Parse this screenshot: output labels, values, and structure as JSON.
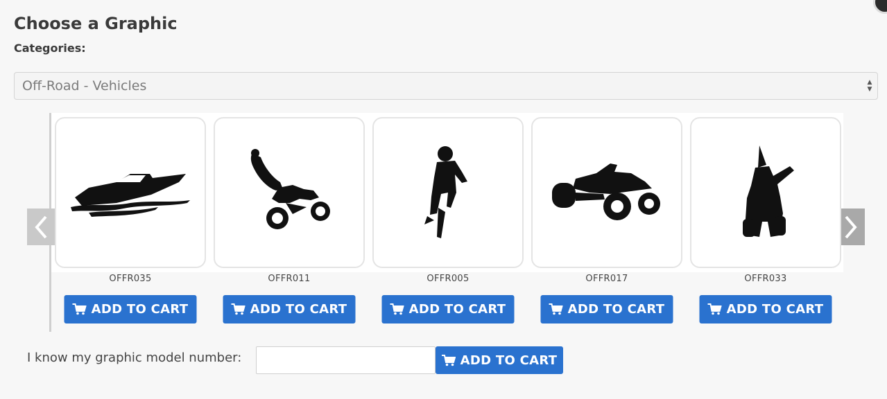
{
  "dialog": {
    "title": "Choose a Graphic",
    "categories_label": "Categories:",
    "selected_category": "Off-Road - Vehicles"
  },
  "carousel": {
    "prev_icon": "chevron-left-icon",
    "next_icon": "chevron-right-icon",
    "items": [
      {
        "code": "OFFR035",
        "graphic": "speedboat-silhouette",
        "button_label": "ADD TO CART"
      },
      {
        "code": "OFFR011",
        "graphic": "motocross-stunt-silhouette",
        "button_label": "ADD TO CART"
      },
      {
        "code": "OFFR005",
        "graphic": "dirt-bike-rider-jump-silhouette",
        "button_label": "ADD TO CART"
      },
      {
        "code": "OFFR017",
        "graphic": "atv-quad-silhouette",
        "button_label": "ADD TO CART"
      },
      {
        "code": "OFFR033",
        "graphic": "atv-rider-front-silhouette",
        "button_label": "ADD TO CART"
      }
    ]
  },
  "model_entry": {
    "label": "I know my graphic model number:",
    "input_value": "",
    "button_label": "ADD TO CART"
  },
  "colors": {
    "button": "#2a72cf",
    "arrow_bg": "#c9c9c9",
    "background": "#f7f7f7"
  }
}
